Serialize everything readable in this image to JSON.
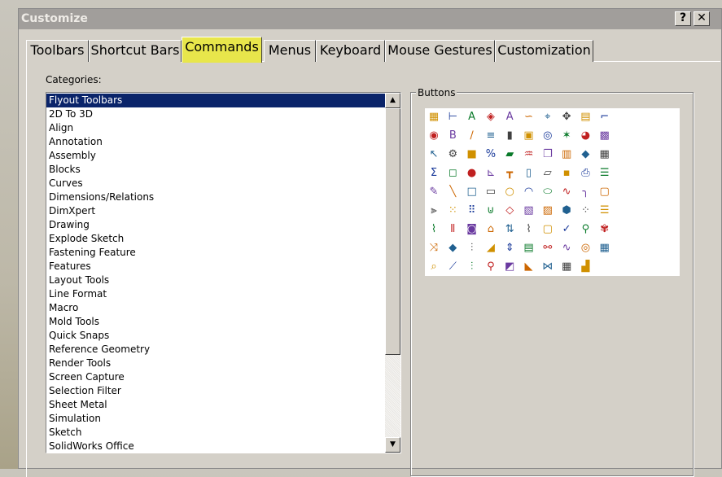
{
  "window": {
    "title": "Customize",
    "help_label": "?",
    "close_label": "✕"
  },
  "tabs": [
    {
      "label": "Toolbars"
    },
    {
      "label": "Shortcut Bars"
    },
    {
      "label": "Commands",
      "active": true
    },
    {
      "label": "Menus"
    },
    {
      "label": "Keyboard"
    },
    {
      "label": "Mouse Gestures"
    },
    {
      "label": "Customization"
    }
  ],
  "categories": {
    "label": "Categories:",
    "selected": "Flyout Toolbars",
    "items": [
      "Flyout Toolbars",
      "2D To 3D",
      "Align",
      "Annotation",
      "Assembly",
      "Blocks",
      "Curves",
      "Dimensions/Relations",
      "DimXpert",
      "Drawing",
      "Explode Sketch",
      "Fastening Feature",
      "Features",
      "Layout Tools",
      "Line Format",
      "Macro",
      "Mold Tools",
      "Quick Snaps",
      "Reference Geometry",
      "Render Tools",
      "Screen Capture",
      "Selection Filter",
      "Sheet Metal",
      "Simulation",
      "Sketch",
      "SolidWorks Office"
    ]
  },
  "buttons": {
    "label": "Buttons",
    "icons": [
      [
        "toolbar-icon",
        "dimension-icon",
        "note-icon",
        "3d-box-icon",
        "text-icon",
        "spline-icon",
        "origin-icon",
        "move-icon",
        "layout-icon",
        "stairs-icon"
      ],
      [
        "globe-icon",
        "bold-italic-icon",
        "sketch-text-icon",
        "lines-icon",
        "chart-icon",
        "frame-icon",
        "target-icon",
        "star-icon",
        "pie-icon",
        "palette-icon"
      ],
      [
        "select-icon",
        "gear-icon",
        "cube-color-icon",
        "percent-icon",
        "book-icon",
        "ribbon-icon",
        "copy-icon",
        "paste-icon",
        "eraser-icon",
        "table-icon"
      ],
      [
        "sigma-icon",
        "cube-outline-icon",
        "sphere-icon",
        "graph-icon",
        "bolt-icon",
        "new-file-icon",
        "open-folder-icon",
        "save-icon",
        "print-icon",
        "checklist-icon"
      ],
      [
        "pencil-icon",
        "line-icon",
        "rectangle-icon",
        "slot-icon",
        "circle-icon",
        "arc-icon",
        "ellipse-icon",
        "curve-icon",
        "fillet-icon",
        "box-icon"
      ],
      [
        "mirror-icon",
        "pattern-icon",
        "grid-icon",
        "magnet-icon",
        "diamond-icon",
        "layer-icon",
        "fill-icon",
        "sphere-yellow-icon",
        "dots-icon",
        "stack-icon"
      ],
      [
        "weld-icon",
        "pipes-icon",
        "camera-icon",
        "house-icon",
        "arrows-icon",
        "spring-icon",
        "monitor-icon",
        "probe-icon",
        "motion-icon",
        "hook-icon"
      ],
      [
        "shuffle-icon",
        "cube-blue-icon",
        "thermometer-icon",
        "mesh-icon",
        "heat-icon",
        "report-icon",
        "link-icon",
        "wave-icon",
        "bullseye-icon",
        "frame-grid-icon"
      ],
      [
        "zoom-icon",
        "chart-edit-icon",
        "temp-icon",
        "sensor-icon",
        "results-icon",
        "plot-icon",
        "stress-icon",
        "mesh-grid-icon",
        "bars-icon",
        ""
      ]
    ]
  }
}
